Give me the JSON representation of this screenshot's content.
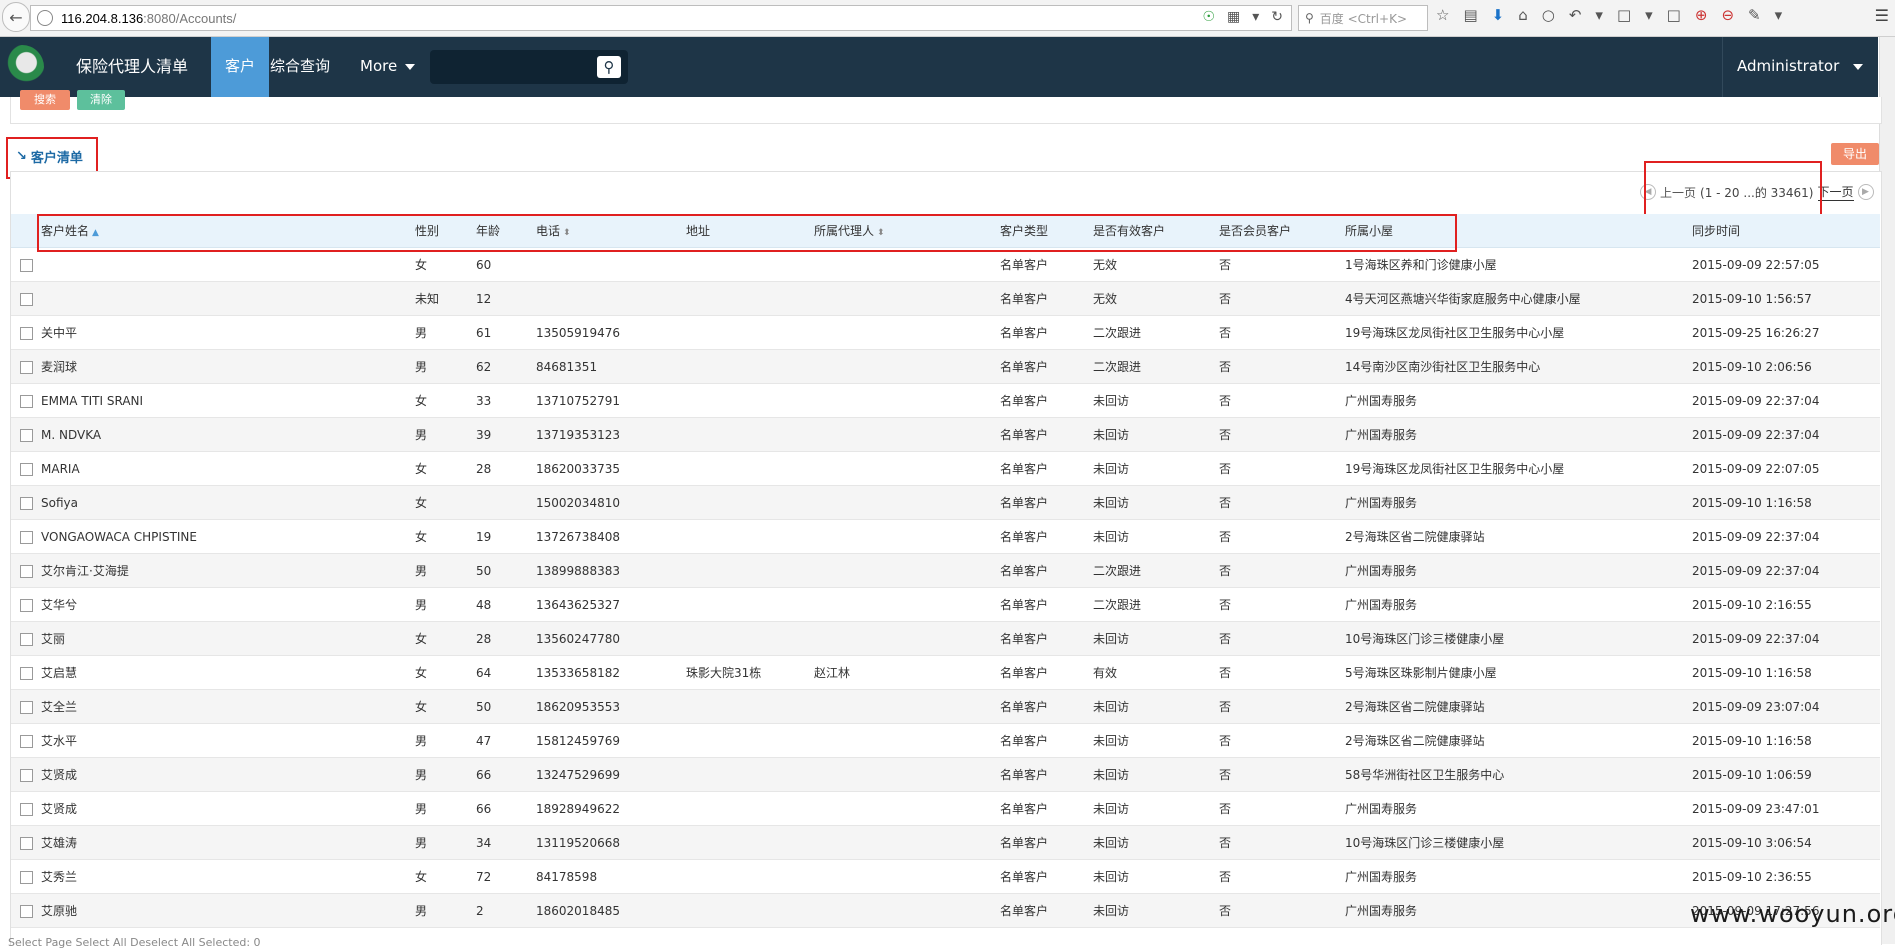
{
  "browser": {
    "url_host": "116.204.8.136",
    "url_rest": ":8080/Accounts/",
    "search_placeholder": "百度 <Ctrl+K>"
  },
  "navbar": {
    "brand": "保险代理人清单",
    "items": [
      {
        "label": "客户",
        "active": true
      },
      {
        "label": "综合查询",
        "active": false
      },
      {
        "label": "More",
        "active": false
      }
    ],
    "user": "Administrator"
  },
  "filters": {
    "search_label": "搜索",
    "clear_label": "清除"
  },
  "section": {
    "title": "客户清单",
    "export_label": "导出"
  },
  "pager": {
    "prev": "上一页",
    "range": "(1 - 20 ...的 33461)",
    "next": "下一页"
  },
  "table": {
    "headers": [
      "客户姓名",
      "性别",
      "年龄",
      "电话",
      "地址",
      "所属代理人",
      "客户类型",
      "是否有效客户",
      "是否会员客户",
      "所属小屋",
      "同步时间"
    ],
    "rows": [
      [
        "",
        "女",
        "60",
        "",
        "",
        "",
        "名单客户",
        "无效",
        "否",
        "1号海珠区养和门诊健康小屋",
        "2015-09-09 22:57:05"
      ],
      [
        "",
        "未知",
        "12",
        "",
        "",
        "",
        "名单客户",
        "无效",
        "否",
        "4号天河区燕塘兴华街家庭服务中心健康小屋",
        "2015-09-10 1:56:57"
      ],
      [
        "关中平",
        "男",
        "61",
        "13505919476",
        "",
        "",
        "名单客户",
        "二次跟进",
        "否",
        "19号海珠区龙凤街社区卫生服务中心小屋",
        "2015-09-25 16:26:27"
      ],
      [
        "麦润球",
        "男",
        "62",
        "84681351",
        "",
        "",
        "名单客户",
        "二次跟进",
        "否",
        "14号南沙区南沙街社区卫生服务中心",
        "2015-09-10 2:06:56"
      ],
      [
        "EMMA TITI SRANI",
        "女",
        "33",
        "13710752791",
        "",
        "",
        "名单客户",
        "未回访",
        "否",
        "广州国寿服务",
        "2015-09-09 22:37:04"
      ],
      [
        "M. NDVKA",
        "男",
        "39",
        "13719353123",
        "",
        "",
        "名单客户",
        "未回访",
        "否",
        "广州国寿服务",
        "2015-09-09 22:37:04"
      ],
      [
        "MARIA",
        "女",
        "28",
        "18620033735",
        "",
        "",
        "名单客户",
        "未回访",
        "否",
        "19号海珠区龙凤街社区卫生服务中心小屋",
        "2015-09-09 22:07:05"
      ],
      [
        "Sofiya",
        "女",
        "",
        "15002034810",
        "",
        "",
        "名单客户",
        "未回访",
        "否",
        "广州国寿服务",
        "2015-09-10 1:16:58"
      ],
      [
        "VONGAOWACA CHPISTINE",
        "女",
        "19",
        "13726738408",
        "",
        "",
        "名单客户",
        "未回访",
        "否",
        "2号海珠区省二院健康驿站",
        "2015-09-09 22:37:04"
      ],
      [
        "艾尔肯江·艾海提",
        "男",
        "50",
        "13899888383",
        "",
        "",
        "名单客户",
        "二次跟进",
        "否",
        "广州国寿服务",
        "2015-09-09 22:37:04"
      ],
      [
        "艾华兮",
        "男",
        "48",
        "13643625327",
        "",
        "",
        "名单客户",
        "二次跟进",
        "否",
        "广州国寿服务",
        "2015-09-10 2:16:55"
      ],
      [
        "艾丽",
        "女",
        "28",
        "13560247780",
        "",
        "",
        "名单客户",
        "未回访",
        "否",
        "10号海珠区门诊三楼健康小屋",
        "2015-09-09 22:37:04"
      ],
      [
        "艾启慧",
        "女",
        "64",
        "13533658182",
        "珠影大院31栋",
        "赵江林",
        "名单客户",
        "有效",
        "否",
        "5号海珠区珠影制片健康小屋",
        "2015-09-10 1:16:58"
      ],
      [
        "艾全兰",
        "女",
        "50",
        "18620953553",
        "",
        "",
        "名单客户",
        "未回访",
        "否",
        "2号海珠区省二院健康驿站",
        "2015-09-09 23:07:04"
      ],
      [
        "艾水平",
        "男",
        "47",
        "15812459769",
        "",
        "",
        "名单客户",
        "未回访",
        "否",
        "2号海珠区省二院健康驿站",
        "2015-09-10 1:16:58"
      ],
      [
        "艾贤成",
        "男",
        "66",
        "13247529699",
        "",
        "",
        "名单客户",
        "未回访",
        "否",
        "58号华洲街社区卫生服务中心",
        "2015-09-10 1:06:59"
      ],
      [
        "艾贤成",
        "男",
        "66",
        "18928949622",
        "",
        "",
        "名单客户",
        "未回访",
        "否",
        "广州国寿服务",
        "2015-09-09 23:47:01"
      ],
      [
        "艾雄涛",
        "男",
        "34",
        "13119520668",
        "",
        "",
        "名单客户",
        "未回访",
        "否",
        "10号海珠区门诊三楼健康小屋",
        "2015-09-10 3:06:54"
      ],
      [
        "艾秀兰",
        "女",
        "72",
        "84178598",
        "",
        "",
        "名单客户",
        "未回访",
        "否",
        "广州国寿服务",
        "2015-09-10 2:36:55"
      ],
      [
        "艾原驰",
        "男",
        "2",
        "18602018485",
        "",
        "",
        "名单客户",
        "未回访",
        "否",
        "广州国寿服务",
        "2015-09-09 17:27:56"
      ]
    ]
  },
  "watermark": "www.wooyun.org",
  "bottom_text": "Select Page  Select All  Deselect All  Selected: 0",
  "colors": {
    "navbar": "#1e3547",
    "active_tab": "#4d9bd8",
    "annotation_red": "#e02020",
    "export_button": "#f08b6a"
  }
}
